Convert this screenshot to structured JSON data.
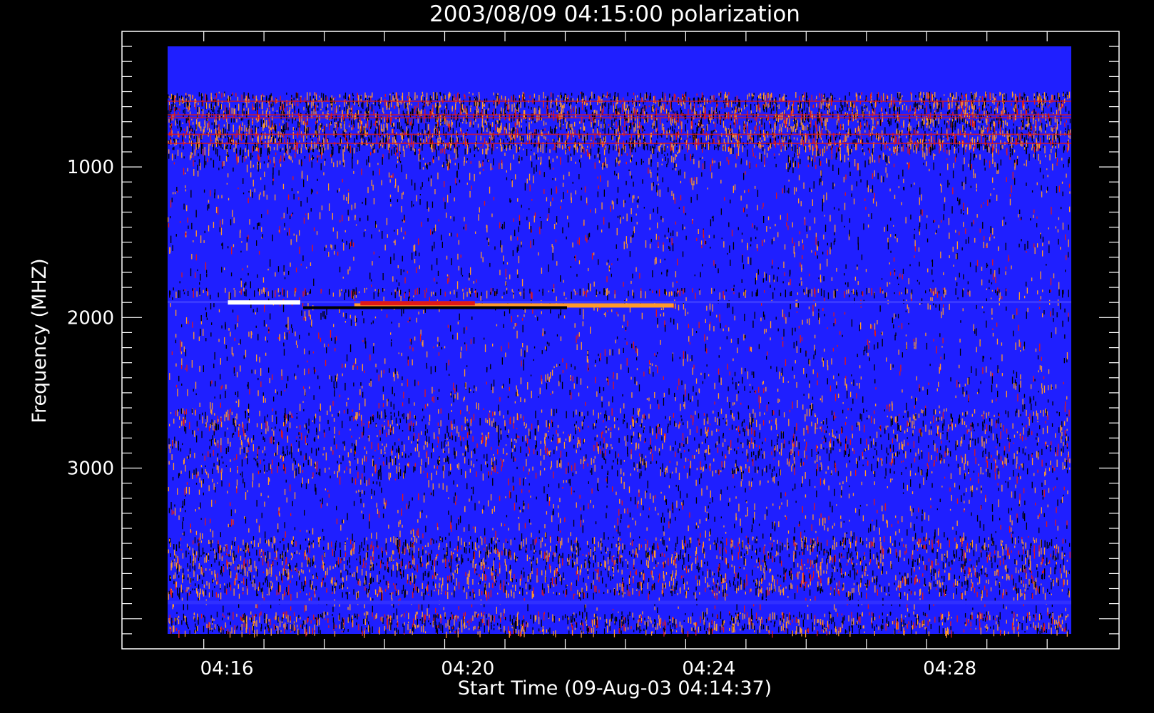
{
  "chart_data": {
    "type": "heatmap",
    "title": "2003/08/09 04:15:00 polarization",
    "xlabel": "Start Time (09-Aug-03 04:14:37)",
    "ylabel": "Frequency (MHZ)",
    "x_start_time": "04:14:37",
    "x_tick_labels": [
      "04:16",
      "04:20",
      "04:24",
      "04:28"
    ],
    "xlim_minutes": [
      4.7,
      16.8
    ],
    "x_data_extent_minutes": [
      0.4,
      15.4
    ],
    "y_tick_labels": [
      "1000",
      "2000",
      "3000"
    ],
    "y_tick_values": [
      1000,
      2000,
      3000
    ],
    "ylim": [
      100,
      4200
    ],
    "y_data_extent": [
      200,
      4100
    ],
    "y_inverted": true,
    "colors": {
      "background": "#000000",
      "plot_fill": "#1f1fff",
      "axis": "#ffffff",
      "speckle_orange": "#ff9a2a",
      "speckle_red": "#e01818",
      "speckle_white": "#ffffff",
      "speckle_black": "#000000"
    },
    "speckle_bands_mhz": [
      {
        "from": 500,
        "to": 900,
        "density": 0.75
      },
      {
        "from": 900,
        "to": 1000,
        "density": 0.28
      },
      {
        "from": 1000,
        "to": 1300,
        "density": 0.1
      },
      {
        "from": 1300,
        "to": 1550,
        "density": 0.12
      },
      {
        "from": 1550,
        "to": 1800,
        "density": 0.08
      },
      {
        "from": 1800,
        "to": 1850,
        "density": 0.45
      },
      {
        "from": 1850,
        "to": 2300,
        "density": 0.1
      },
      {
        "from": 2300,
        "to": 2600,
        "density": 0.12
      },
      {
        "from": 2600,
        "to": 3050,
        "density": 0.3
      },
      {
        "from": 3050,
        "to": 3450,
        "density": 0.12
      },
      {
        "from": 3450,
        "to": 3850,
        "density": 0.45
      },
      {
        "from": 3850,
        "to": 3950,
        "density": 0.08
      },
      {
        "from": 3950,
        "to": 4100,
        "density": 0.55
      }
    ],
    "bright_bursts": [
      {
        "start_min": 3.5,
        "end_min": 8.8,
        "freq_mhz": 1920,
        "color": "#ff9a2a"
      },
      {
        "start_min": 1.4,
        "end_min": 2.6,
        "freq_mhz": 1900,
        "color": "#ffffff"
      },
      {
        "start_min": 3.6,
        "end_min": 5.5,
        "freq_mhz": 1905,
        "color": "#e01818"
      }
    ]
  }
}
